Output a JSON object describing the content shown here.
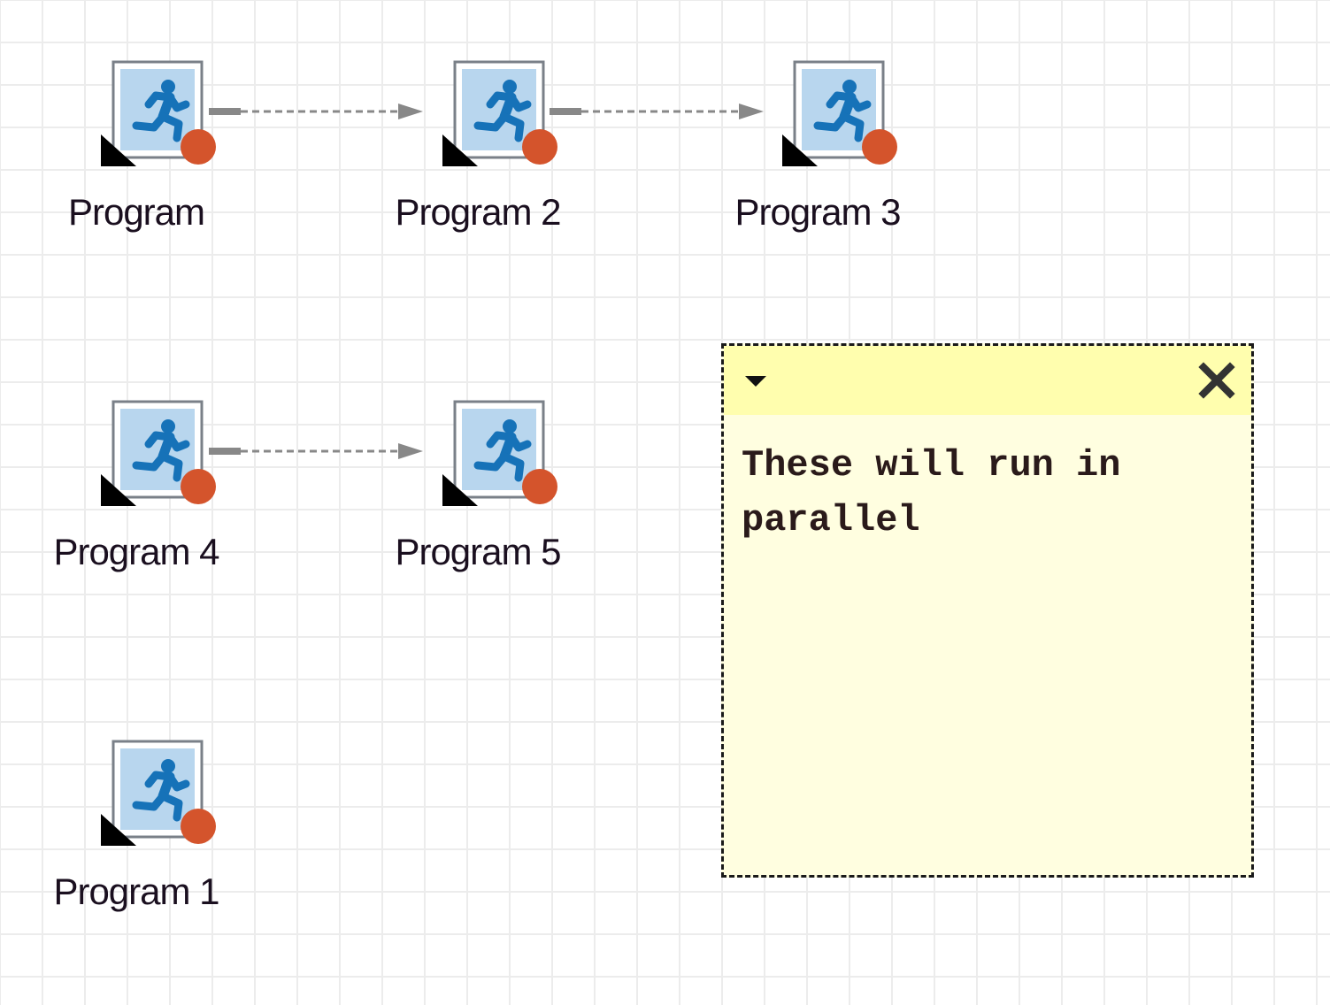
{
  "canvas": {
    "grid": true,
    "background": "#ffffff",
    "grid_color": "#ececec"
  },
  "nodes": [
    {
      "id": "program",
      "label": "Program",
      "icon": "running-person-icon"
    },
    {
      "id": "program-2",
      "label": "Program 2",
      "icon": "running-person-icon"
    },
    {
      "id": "program-3",
      "label": "Program 3",
      "icon": "running-person-icon"
    },
    {
      "id": "program-4",
      "label": "Program 4",
      "icon": "running-person-icon"
    },
    {
      "id": "program-5",
      "label": "Program 5",
      "icon": "running-person-icon"
    },
    {
      "id": "program-1",
      "label": "Program 1",
      "icon": "running-person-icon"
    }
  ],
  "connections": [
    {
      "from": "Program",
      "to": "Program 2",
      "style": "dashed"
    },
    {
      "from": "Program 2",
      "to": "Program 3",
      "style": "dashed"
    },
    {
      "from": "Program 4",
      "to": "Program 5",
      "style": "dashed"
    }
  ],
  "note": {
    "text": "These will run in parallel",
    "menu_icon": "dropdown-arrow-icon",
    "close_icon": "close-icon",
    "header_color": "#fffeae",
    "body_color": "#fffee0"
  },
  "colors": {
    "icon_frame": "#7a8088",
    "icon_background": "#b8d6ee",
    "runner": "#1672b8",
    "status_dot": "#d4542c",
    "shortcut_corner": "#000000",
    "connector": "#888888"
  }
}
